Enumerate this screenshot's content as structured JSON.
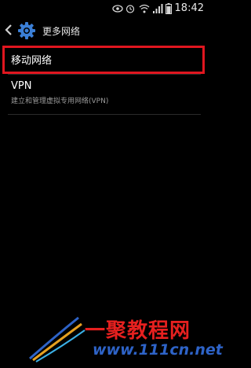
{
  "status_bar": {
    "time": "18:42",
    "icons": [
      "eye-icon",
      "alarm-icon",
      "wifi-icon",
      "signal-icon",
      "battery-icon"
    ]
  },
  "header": {
    "title": "更多网络",
    "back_icon": "chevron-left-icon",
    "settings_icon": "gear-icon"
  },
  "items": [
    {
      "title": "移动网络",
      "highlighted": true
    },
    {
      "title": "VPN",
      "subtitle": "建立和管理虚拟专用网络(VPN)"
    }
  ],
  "watermark": {
    "text": "一聚教程网",
    "url": "www.111cn.net"
  },
  "colors": {
    "highlight": "#e0161f",
    "watermark_red": "#e6201f",
    "watermark_blue": "#2e63c7"
  }
}
